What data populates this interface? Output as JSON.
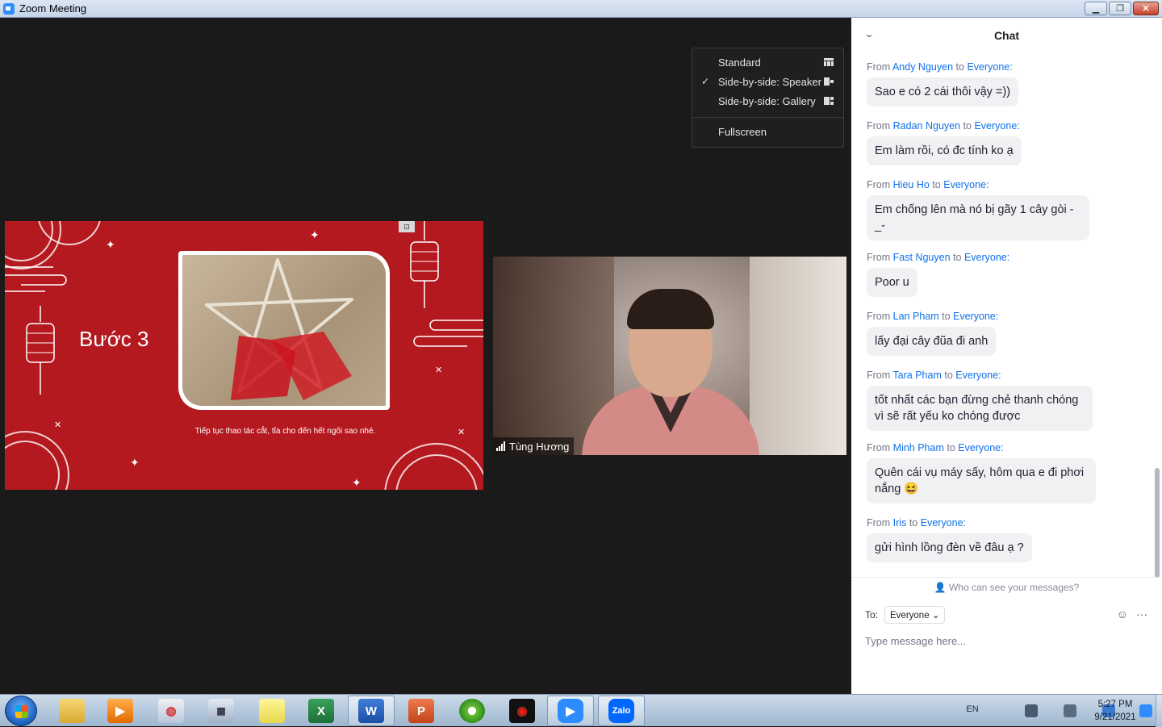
{
  "window": {
    "title": "Zoom Meeting"
  },
  "view_menu": {
    "items": [
      {
        "label": "Standard",
        "checked": false
      },
      {
        "label": "Side-by-side: Speaker",
        "checked": true
      },
      {
        "label": "Side-by-side: Gallery",
        "checked": false
      }
    ],
    "fullscreen_label": "Fullscreen",
    "check_mark": "✓"
  },
  "shared_slide": {
    "title": "Bước 3",
    "caption": "Tiếp tục thao tác cắt, tỉa cho đến hết ngôi sao nhé."
  },
  "speaker_video": {
    "name": "Tùng Hương"
  },
  "chat": {
    "title": "Chat",
    "from_word": "From",
    "to_word": "to",
    "messages": [
      {
        "sender": "Andy Nguyen",
        "recipient": "Everyone:",
        "text": "Sao e có 2 cái thôi vậy =))"
      },
      {
        "sender": "Radan Nguyen",
        "recipient": "Everyone:",
        "text": "Em làm rồi, có đc tính ko ạ"
      },
      {
        "sender": "Hieu Ho",
        "recipient": "Everyone:",
        "text": "Em chống lên mà nó bị gãy 1 cây gòi -_-"
      },
      {
        "sender": "Fast Nguyen",
        "recipient": "Everyone:",
        "text": "Poor u"
      },
      {
        "sender": "Lan Pham",
        "recipient": "Everyone:",
        "text": "lấy đại cây đũa đi anh"
      },
      {
        "sender": "Tara Pham",
        "recipient": "Everyone:",
        "text": "tốt nhất các bạn đừng chẻ thanh chóng vì sẽ rất yếu ko chóng được"
      },
      {
        "sender": "Minh Pham",
        "recipient": "Everyone:",
        "text": "Quên cái vụ máy sấy, hôm qua e đi phơi nắng 😆"
      },
      {
        "sender": "Iris",
        "recipient": "Everyone:",
        "text": "gửi hình lồng đèn về đâu ạ ?"
      }
    ],
    "who_can_see": "Who can see your messages?",
    "to_label": "To:",
    "to_value": "Everyone",
    "input_placeholder": "Type message here..."
  },
  "taskbar": {
    "apps": [
      "Windows Explorer",
      "Media",
      "Paint",
      "Calculator",
      "Sticky Notes",
      "Excel",
      "Word",
      "PowerPoint",
      "Chrome",
      "Garena",
      "Zoom",
      "Zalo"
    ],
    "zalo_label": "Zalo",
    "language": "EN",
    "time": "5:27 PM",
    "date": "9/21/2021"
  }
}
